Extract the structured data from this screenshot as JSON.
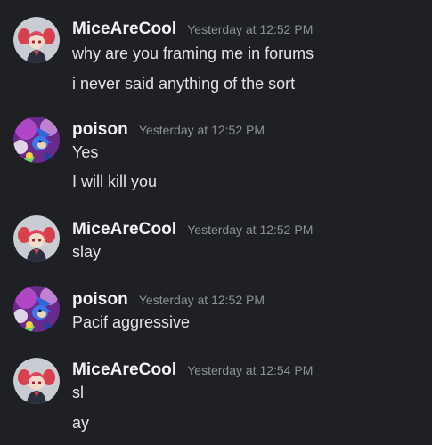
{
  "channel": {
    "messages": [
      {
        "author": "MiceAreCool",
        "avatar_icon": "red-haired-anime-avatar-icon",
        "timestamp": "Yesterday at 12:52 PM",
        "lines": [
          "why are you framing me in forums",
          "i never said anything of the sort"
        ]
      },
      {
        "author": "poison",
        "avatar_icon": "purple-hedgehog-collage-avatar-icon",
        "timestamp": "Yesterday at 12:52 PM",
        "lines": [
          "Yes",
          "I will kill you"
        ]
      },
      {
        "author": "MiceAreCool",
        "avatar_icon": "red-haired-anime-avatar-icon",
        "timestamp": "Yesterday at 12:52 PM",
        "lines": [
          "slay"
        ]
      },
      {
        "author": "poison",
        "avatar_icon": "purple-hedgehog-collage-avatar-icon",
        "timestamp": "Yesterday at 12:52 PM",
        "lines": [
          "Pacif aggressive"
        ]
      },
      {
        "author": "MiceAreCool",
        "avatar_icon": "red-haired-anime-avatar-icon",
        "timestamp": "Yesterday at 12:54 PM",
        "lines": [
          "sl",
          "ay"
        ]
      }
    ]
  },
  "colors": {
    "background": "#1f2023",
    "username": "#f2f3f5",
    "timestamp": "#8e9199",
    "message_text": "#e3e4e8"
  }
}
